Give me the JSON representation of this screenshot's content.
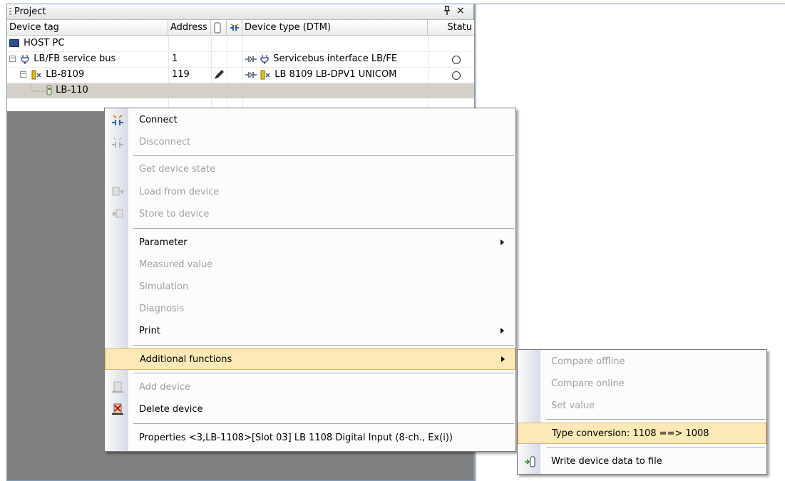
{
  "project_pane": {
    "title": "Project",
    "pin_glyph": "ű",
    "close_glyph": "×",
    "columns": [
      "Device tag",
      "Address",
      "",
      "",
      "Device type (DTM)",
      "Statu"
    ],
    "rows": [
      {
        "tag": "HOST PC",
        "address": "",
        "type": ""
      },
      {
        "tag": "LB/FB service bus",
        "address": "1",
        "type": "Servicebus interface LB/FE"
      },
      {
        "tag": "LB-8109",
        "address": "119",
        "type": "LB 8109 LB-DPV1 UNICOM"
      },
      {
        "tag": "LB-110",
        "address": "",
        "type": ""
      }
    ]
  },
  "context_menu": {
    "items": [
      {
        "label": "Connect",
        "enabled": true,
        "icon": "connect-icon"
      },
      {
        "label": "Disconnect",
        "enabled": false,
        "icon": "disconnect-icon"
      },
      {
        "label": "Get device state",
        "enabled": false
      },
      {
        "label": "Load from device",
        "enabled": false,
        "icon": "load-from-device-icon"
      },
      {
        "label": "Store to device",
        "enabled": false,
        "icon": "store-to-device-icon"
      },
      {
        "label": "Parameter",
        "enabled": true,
        "submenu": true
      },
      {
        "label": "Measured value",
        "enabled": false
      },
      {
        "label": "Simulation",
        "enabled": false
      },
      {
        "label": "Diagnosis",
        "enabled": false
      },
      {
        "label": "Print",
        "enabled": true,
        "submenu": true
      },
      {
        "label": "Additional functions",
        "enabled": true,
        "submenu": true,
        "highlighted": true
      },
      {
        "label": "Add device",
        "enabled": false,
        "icon": "add-device-icon"
      },
      {
        "label": "Delete device",
        "enabled": true,
        "icon": "delete-device-icon"
      },
      {
        "label": "Properties <3,LB-1108>[Slot 03] LB 1108 Digital Input (8-ch., Ex(i))",
        "enabled": true
      }
    ]
  },
  "submenu": {
    "items": [
      {
        "label": "Compare offline",
        "enabled": false
      },
      {
        "label": "Compare online",
        "enabled": false
      },
      {
        "label": "Set value",
        "enabled": false
      },
      {
        "label": "Type conversion: 1108 ==> 1008",
        "enabled": true,
        "highlighted": true
      },
      {
        "label": "Write device data to file",
        "enabled": true,
        "icon": "write-file-icon"
      }
    ]
  },
  "colors": {
    "highlight_bg": "#fde9b6",
    "highlight_border": "#e0b560",
    "disabled_text": "#a0a0a0",
    "pane_background": "#808080"
  }
}
